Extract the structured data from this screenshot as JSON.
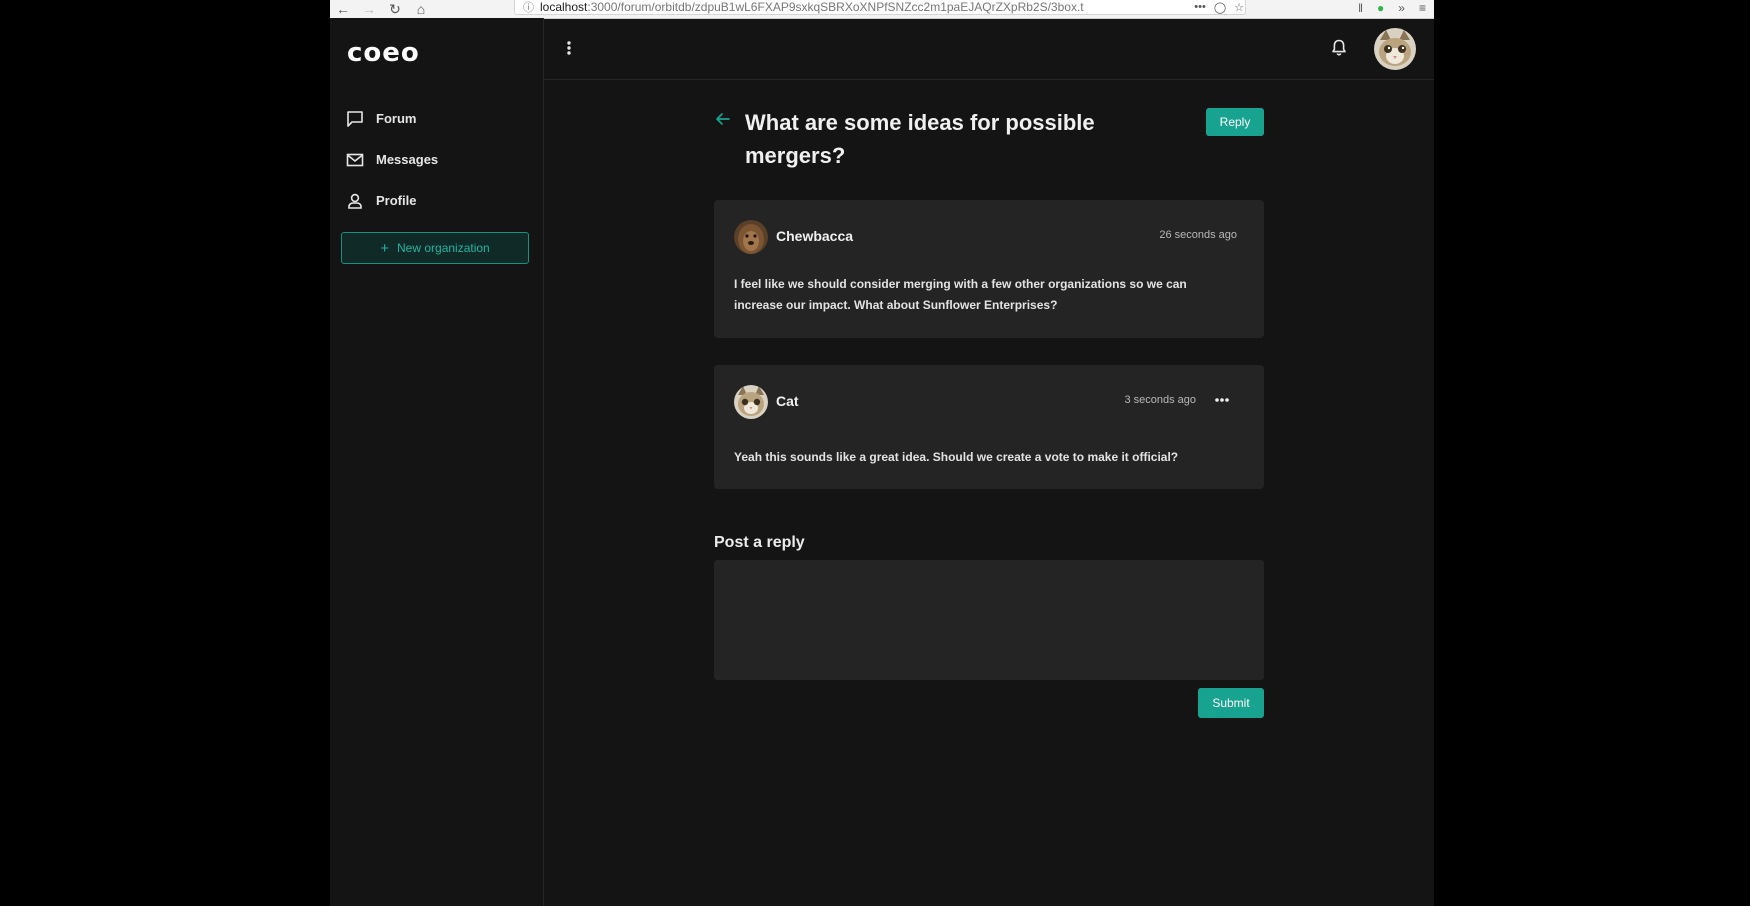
{
  "browser": {
    "url_host": "localhost",
    "url_rest": ":3000/forum/orbitdb/zdpuB1wL6FXAP9sxkqSBRXoXNPfSNZcc2m1paEJAQrZXpRb2S/3box.t",
    "back_icon": "arrow-left-icon",
    "forward_icon": "arrow-right-icon",
    "reload_icon": "reload-icon",
    "home_icon": "home-icon"
  },
  "app": {
    "logo": "coeo",
    "accent_color": "#18a391"
  },
  "sidebar": {
    "items": [
      {
        "label": "Forum",
        "icon": "chat-bubble-icon"
      },
      {
        "label": "Messages",
        "icon": "envelope-icon"
      },
      {
        "label": "Profile",
        "icon": "person-icon"
      }
    ],
    "new_org_label": "New organization"
  },
  "thread": {
    "title": "What are some ideas for possible mergers?",
    "reply_label": "Reply",
    "posts": [
      {
        "author": "Chewbacca",
        "time": "26 seconds ago",
        "body": "I feel like we should consider merging with a few other organizations so we can increase our impact. What about Sunflower Enterprises?"
      },
      {
        "author": "Cat",
        "time": "3 seconds ago",
        "body": "Yeah this sounds like a great idea. Should we create a vote to make it official?"
      }
    ]
  },
  "reply_form": {
    "heading": "Post a reply",
    "value": "",
    "submit_label": "Submit"
  }
}
